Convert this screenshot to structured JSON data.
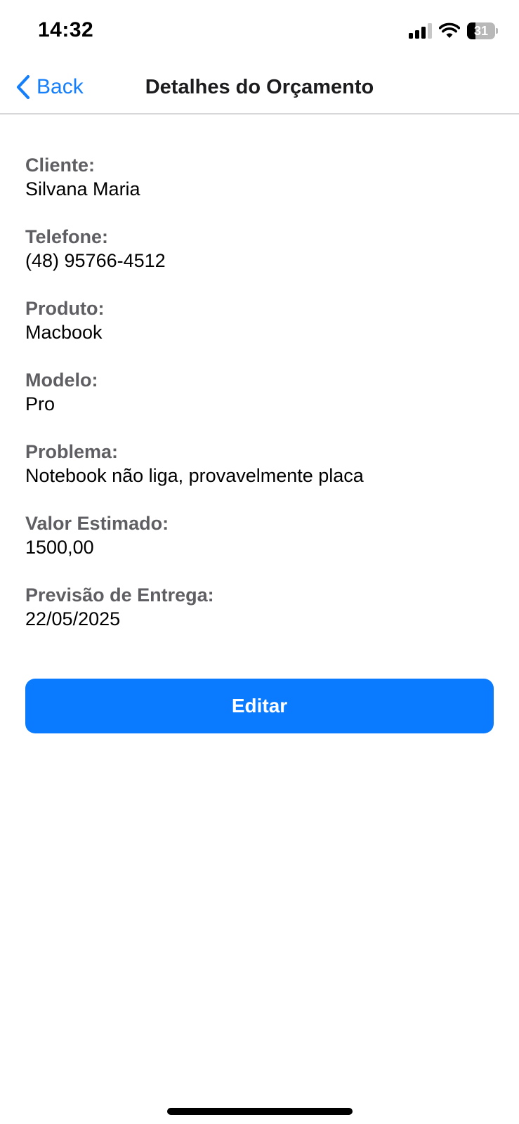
{
  "status_bar": {
    "time": "14:32",
    "signal_bars_active": 3,
    "signal_bars_total": 4,
    "wifi_icon": "wifi-icon",
    "battery_level": "31",
    "battery_fraction": 0.31
  },
  "nav": {
    "back_label": "Back",
    "back_icon": "chevron-left-icon",
    "title": "Detalhes do Orçamento"
  },
  "details": [
    {
      "label": "Cliente:",
      "value": "Silvana Maria"
    },
    {
      "label": "Telefone:",
      "value": "(48) 95766-4512"
    },
    {
      "label": "Produto:",
      "value": "Macbook"
    },
    {
      "label": "Modelo:",
      "value": "Pro"
    },
    {
      "label": "Problema:",
      "value": "Notebook não liga, provavelmente placa"
    },
    {
      "label": "Valor Estimado:",
      "value": "1500,00"
    },
    {
      "label": "Previsão de Entrega:",
      "value": "22/05/2025"
    }
  ],
  "actions": {
    "edit_label": "Editar"
  },
  "colors": {
    "accent": "#0a7aff",
    "label": "#5f5f63",
    "divider": "#d7d7d9"
  }
}
